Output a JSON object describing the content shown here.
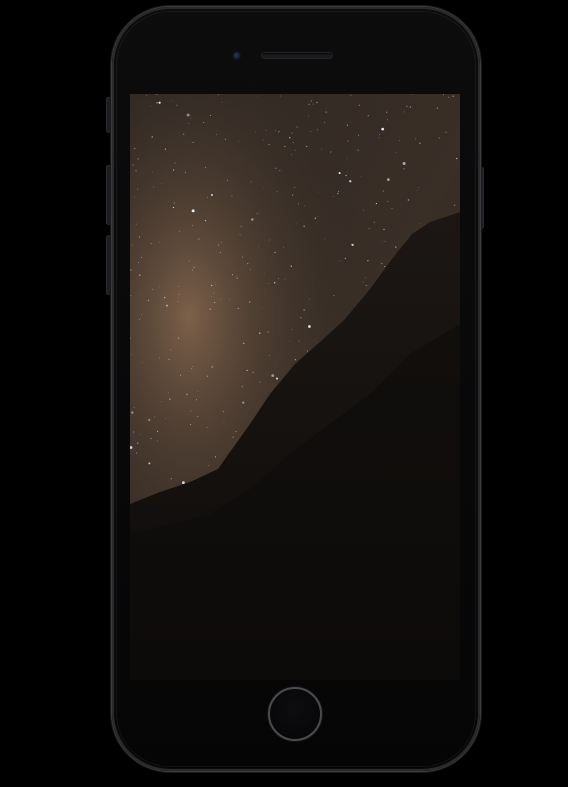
{
  "device": {
    "type": "smartphone",
    "color": "jet-black",
    "frame_color": "#050506",
    "bezel_highlight": "#3c3c40"
  },
  "wallpaper": {
    "subject": "milky-way-night-sky-over-rock",
    "sky_colors": [
      "#2b2520",
      "#4a3b2e",
      "#7a604a"
    ],
    "rock_color": "#120f0d"
  },
  "controls": {
    "home_button_icon": "home-button-ring",
    "camera_icon": "front-camera-icon",
    "speaker_icon": "earpiece-speaker-icon"
  }
}
